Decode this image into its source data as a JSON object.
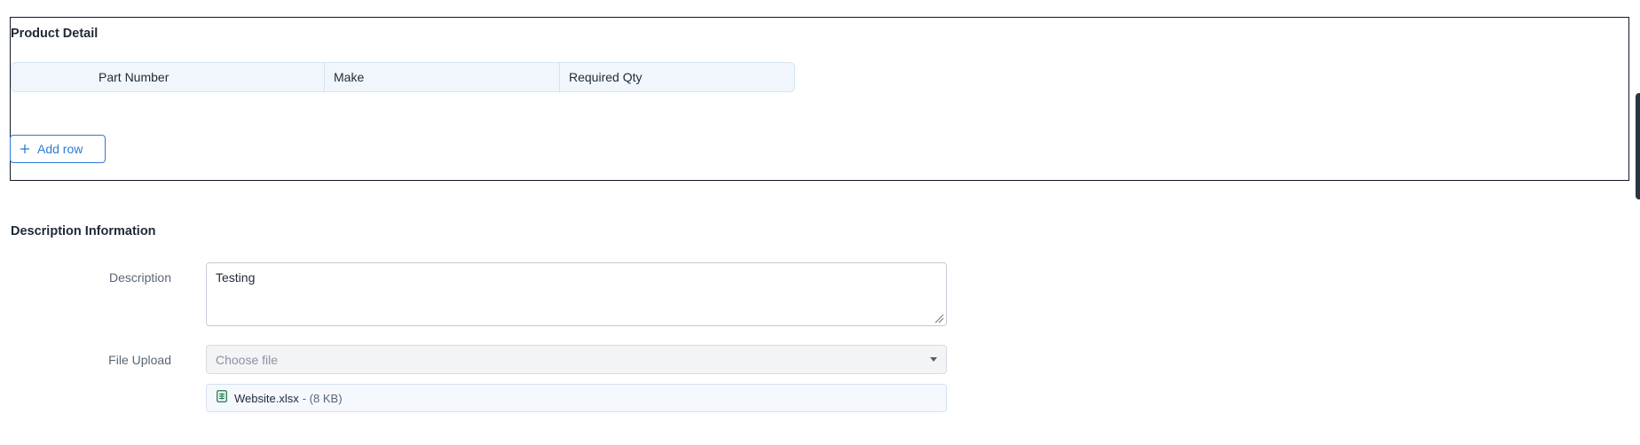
{
  "product_detail": {
    "title": "Product Detail",
    "columns": [
      "Part Number",
      "Make",
      "Required Qty"
    ],
    "add_row_label": "Add row",
    "add_row_icon": "plus-icon"
  },
  "description_info": {
    "title": "Description Information",
    "description": {
      "label": "Description",
      "value": "Testing"
    },
    "file_upload": {
      "label": "File Upload",
      "placeholder": "Choose file",
      "file": {
        "name": "Website.xlsx",
        "size": " - (8 KB)",
        "icon": "spreadsheet-file-icon"
      }
    }
  },
  "colors": {
    "accent": "#2b7bd6",
    "section_border": "#111827",
    "header_bg": "#f1f6fd"
  }
}
